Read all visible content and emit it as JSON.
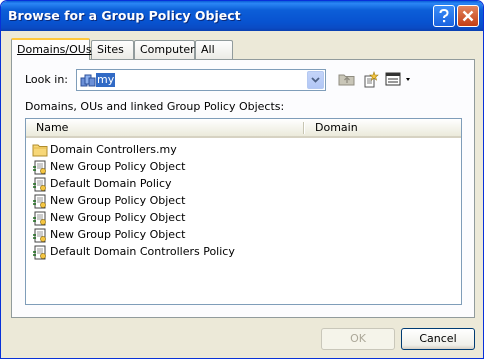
{
  "window": {
    "title": "Browse for a Group Policy Object"
  },
  "titlebar": {
    "help_icon": "help-icon",
    "close_icon": "close-icon"
  },
  "tabs": [
    {
      "label": "Domains/OUs",
      "active": true
    },
    {
      "label": "Sites",
      "active": false
    },
    {
      "label": "Computers",
      "active": false
    },
    {
      "label": "All",
      "active": false
    }
  ],
  "lookin": {
    "label": "Look in:",
    "value": "my",
    "icon": "domain-icon"
  },
  "toolbar": {
    "icons": [
      "up-folder-icon",
      "new-gpo-icon",
      "view-menu-icon"
    ]
  },
  "list": {
    "label": "Domains, OUs and linked Group Policy Objects:",
    "columns": [
      "Name",
      "Domain"
    ],
    "rows": [
      {
        "name": "Domain Controllers.my",
        "icon": "folder-icon"
      },
      {
        "name": "New Group Policy Object",
        "icon": "gpo-icon"
      },
      {
        "name": "Default Domain Policy",
        "icon": "gpo-icon"
      },
      {
        "name": "New Group Policy Object",
        "icon": "gpo-icon"
      },
      {
        "name": "New Group Policy Object",
        "icon": "gpo-icon"
      },
      {
        "name": "New Group Policy Object",
        "icon": "gpo-icon"
      },
      {
        "name": "Default Domain Controllers Policy",
        "icon": "gpo-icon"
      }
    ]
  },
  "buttons": {
    "ok": "OK",
    "ok_enabled": false,
    "cancel": "Cancel"
  },
  "colors": {
    "titlebar": "#0853d0",
    "face": "#ece9d8",
    "selection": "#316ac5",
    "tab_highlight": "#ffc83c"
  }
}
